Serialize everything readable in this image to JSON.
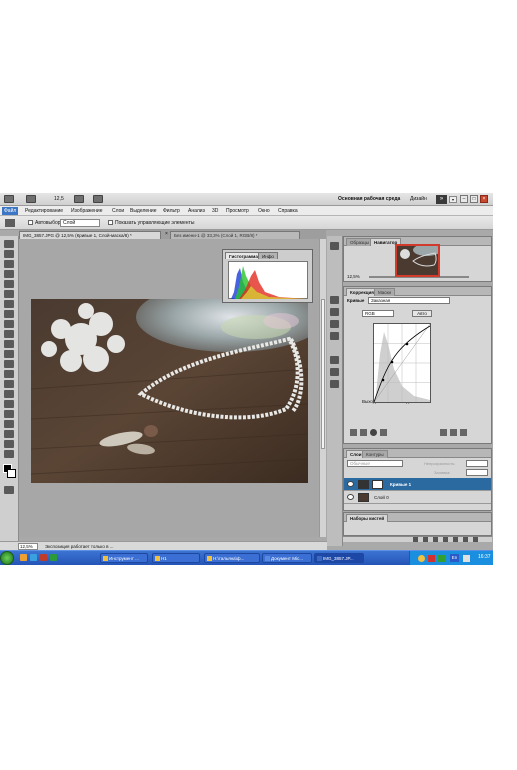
{
  "app": {
    "zoom_display": "12,5",
    "workspace": "Основная рабочая среда",
    "design_label": "Дизайн",
    "more_glyph": "»",
    "dropdown_glyph": "▾",
    "window_buttons": [
      "–",
      "□",
      "×"
    ]
  },
  "menu": {
    "items": [
      "Файл",
      "Редактирование",
      "Изображение",
      "Слои",
      "Выделение",
      "Фильтр",
      "Анализ",
      "3D",
      "Просмотр",
      "Окно",
      "Справка"
    ]
  },
  "options": {
    "autoselect_label": "Автовыбор:",
    "autoselect_value": "Слой",
    "show_controls_label": "Показать управляющие элементы"
  },
  "documents": {
    "tabs": [
      "IMG_3857.JPG @ 12,5% (Кривые 1, Слой-маска/8) *",
      "Без имени-1 @ 33,3% (Слой 1, RGB/8) *"
    ],
    "close_glyph": "×"
  },
  "histogram_panel": {
    "tabs": [
      "Гистограмма",
      "Инфо"
    ]
  },
  "status": {
    "zoom": "12,5%",
    "message": "Экспозиция работает только в ..."
  },
  "navigator_panel": {
    "tabs": [
      "Образцы",
      "Навигатор"
    ],
    "zoom": "12,5%"
  },
  "adjustments_panel": {
    "tabs": [
      "Коррекция",
      "Маски"
    ],
    "preset_label": "Кривые",
    "preset_value": "Заказная",
    "channel": "RGB",
    "auto_label": "Авто",
    "output_label": "Выход:",
    "input_label": "Вход:"
  },
  "layers_panel": {
    "tabs": [
      "Слои",
      "Контуры"
    ],
    "blend_mode": "Обычные",
    "opacity_label": "Непрозрачность:",
    "fill_label": "Заливка:",
    "layers": [
      "Кривые 1",
      "Слой 0"
    ]
  },
  "brushes_panel": {
    "title": "Наборы кистей"
  },
  "taskbar": {
    "items": [
      "Инструмент ...",
      "Н1",
      "Н:\\тальяна\\ф...",
      "Документ Mic...",
      "IMG_3857.JP..."
    ],
    "tray_lang": "En",
    "clock": "16:37"
  },
  "colors": {
    "selected_layer": "#2a6aa0",
    "taskbar": "#2454b7",
    "close_button": "#c9482f",
    "navigator_frame": "#d23a2b"
  }
}
